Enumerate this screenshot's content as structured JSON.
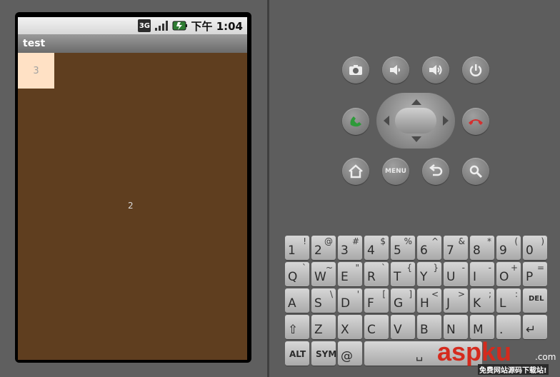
{
  "status_bar": {
    "network": "3G",
    "time_prefix": "下午",
    "time": "1:04",
    "signal_icon": "signal-bars-icon",
    "battery_icon": "battery-charging-icon"
  },
  "app": {
    "title": "test",
    "top_left_box_label": "3",
    "center_label": "2"
  },
  "hardware": {
    "buttons": [
      {
        "name": "camera-button",
        "icon": "camera-icon"
      },
      {
        "name": "volume-down-button",
        "icon": "volume-down-icon"
      },
      {
        "name": "volume-up-button",
        "icon": "volume-up-icon"
      },
      {
        "name": "power-button",
        "icon": "power-icon"
      },
      {
        "name": "call-button",
        "icon": "phone-green-icon"
      },
      {
        "name": "end-call-button",
        "icon": "phone-red-icon"
      },
      {
        "name": "home-button",
        "icon": "home-icon"
      },
      {
        "name": "menu-button",
        "label": "MENU"
      },
      {
        "name": "back-button",
        "icon": "back-icon"
      },
      {
        "name": "search-button",
        "icon": "search-icon"
      }
    ]
  },
  "keyboard": {
    "rows": [
      [
        [
          "1",
          "!"
        ],
        [
          "2",
          "@"
        ],
        [
          "3",
          "#"
        ],
        [
          "4",
          "$"
        ],
        [
          "5",
          "%"
        ],
        [
          "6",
          "^"
        ],
        [
          "7",
          "&"
        ],
        [
          "8",
          "*"
        ],
        [
          "9",
          "("
        ],
        [
          "0",
          ")"
        ]
      ],
      [
        [
          "Q",
          "`"
        ],
        [
          "W",
          "~"
        ],
        [
          "E",
          "\""
        ],
        [
          "R",
          "`"
        ],
        [
          "T",
          "{"
        ],
        [
          "Y",
          "}"
        ],
        [
          "U",
          "-"
        ],
        [
          "I",
          "-"
        ],
        [
          "O",
          "+"
        ],
        [
          "P",
          "="
        ]
      ],
      [
        [
          "A",
          ""
        ],
        [
          "S",
          "\\"
        ],
        [
          "D",
          "'"
        ],
        [
          "F",
          "["
        ],
        [
          "G",
          "]"
        ],
        [
          "H",
          "<"
        ],
        [
          "J",
          ">"
        ],
        [
          "K",
          ";"
        ],
        [
          "L",
          ":"
        ],
        [
          "DEL",
          ""
        ]
      ],
      [
        [
          "⇧",
          ""
        ],
        [
          "Z",
          ""
        ],
        [
          "X",
          ""
        ],
        [
          "C",
          ""
        ],
        [
          "V",
          ""
        ],
        [
          "B",
          ""
        ],
        [
          "N",
          ""
        ],
        [
          "M",
          ""
        ],
        [
          ".",
          ""
        ],
        [
          "↵",
          ""
        ]
      ]
    ],
    "bottom": {
      "alt": "ALT",
      "sym": "SYM",
      "at": "@",
      "space": "␣"
    }
  },
  "watermark": {
    "text": "aspku",
    "suffix": ".com",
    "subtitle": "免费网站源码下载站!"
  }
}
